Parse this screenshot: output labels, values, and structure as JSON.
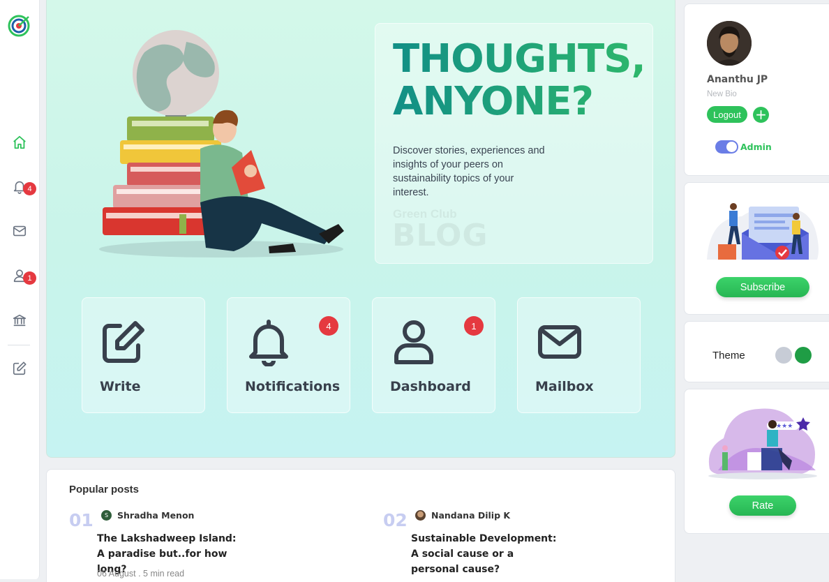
{
  "sidebar": {
    "items": [
      {
        "name": "home",
        "icon": "home-icon",
        "badge": ""
      },
      {
        "name": "notifications",
        "icon": "bell-icon",
        "badge": "4"
      },
      {
        "name": "mail",
        "icon": "mail-icon",
        "badge": ""
      },
      {
        "name": "profile",
        "icon": "user-icon",
        "badge": "1"
      },
      {
        "name": "institution",
        "icon": "bank-icon",
        "badge": ""
      },
      {
        "name": "write",
        "icon": "edit-icon",
        "badge": ""
      }
    ],
    "active_color": "#2ec25b"
  },
  "hero": {
    "title_line1": "THOUGHTS,",
    "title_line2": "ANYONE?",
    "description": "Discover stories, experiences and insights of your peers on sustainability topics of your interest.",
    "watermark_small": "Green Club",
    "watermark_big": "BLOG"
  },
  "tiles": [
    {
      "label": "Write",
      "icon": "edit-icon",
      "badge": ""
    },
    {
      "label": "Notifications",
      "icon": "bell-icon",
      "badge": "4"
    },
    {
      "label": "Dashboard",
      "icon": "user-icon",
      "badge": "1"
    },
    {
      "label": "Mailbox",
      "icon": "mail-icon",
      "badge": ""
    }
  ],
  "posts": {
    "title": "Popular posts",
    "items": [
      {
        "num": "01",
        "author": "Shradha Menon",
        "avatar_letter": "S",
        "title": "The Lakshadweep Island: A paradise but..for how long?",
        "meta": "06 August . 5 min read"
      },
      {
        "num": "02",
        "author": "Nandana Dilip K",
        "avatar_letter": "",
        "title": "Sustainable Development: A social cause or a personal cause?",
        "meta": ""
      }
    ]
  },
  "profile": {
    "name": "Ananthu JP",
    "bio": "New Bio",
    "logout_label": "Logout",
    "plus_label": "+",
    "toggle_label": "Admin"
  },
  "subscribe": {
    "button_label": "Subscribe"
  },
  "theme": {
    "label": "Theme",
    "swatches": [
      "#c7ccd6",
      "#1f9d45"
    ]
  },
  "rate": {
    "button_label": "Rate"
  }
}
